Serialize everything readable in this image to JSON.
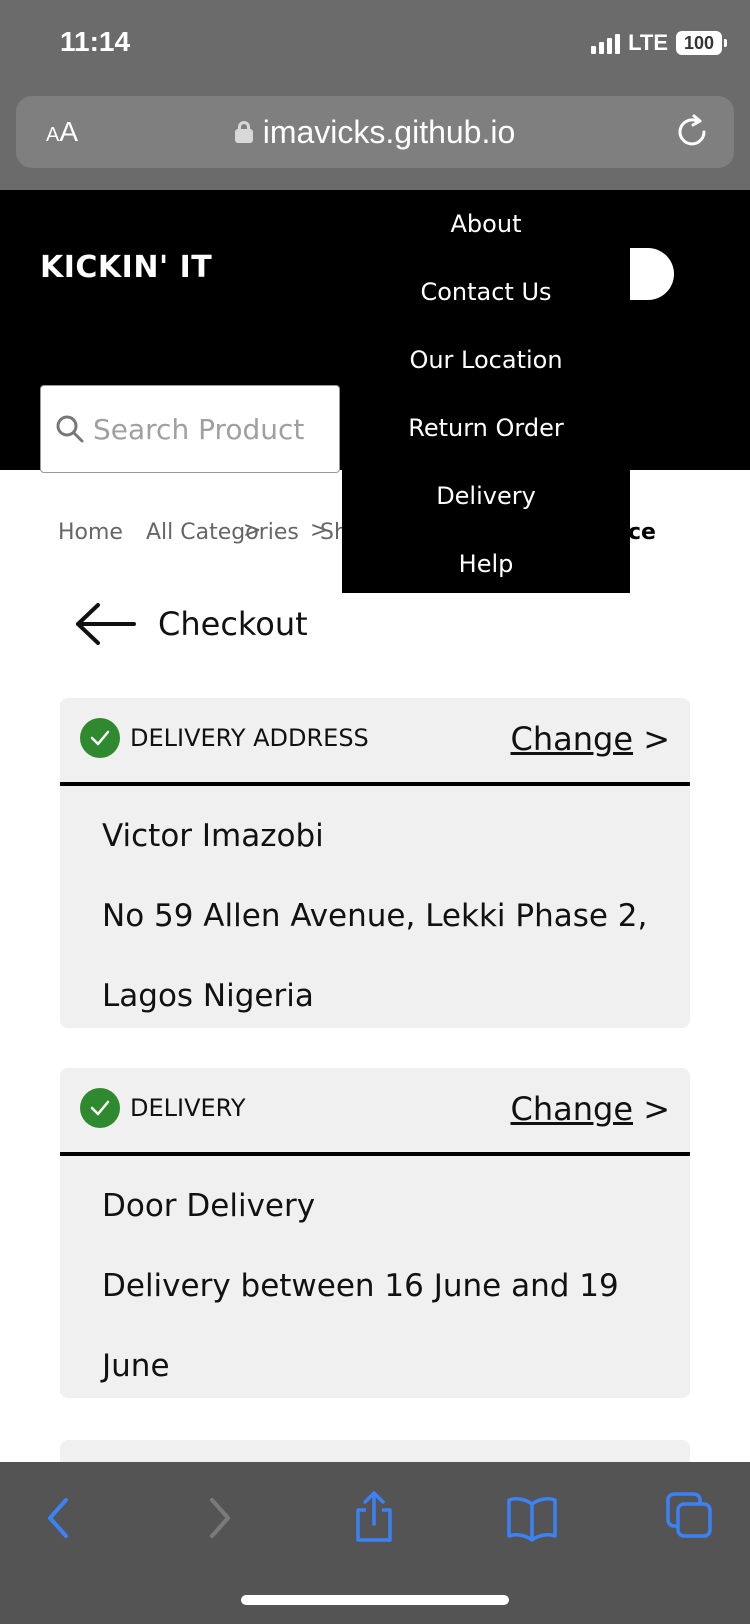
{
  "status_bar": {
    "time": "11:14",
    "network": "LTE",
    "battery": "100"
  },
  "browser": {
    "aa_small": "A",
    "aa_big": "A",
    "url": "imavicks.github.io"
  },
  "header": {
    "brand": "KICKIN' IT",
    "search_placeholder": "Search Product"
  },
  "dropdown": {
    "items": [
      "About",
      "Contact Us",
      "Our Location",
      "Return Order",
      "Delivery",
      "Help"
    ]
  },
  "breadcrumb": {
    "home": "Home",
    "categories": "All Categories",
    "partial": "Sh",
    "tail": "ce",
    "sep": ">"
  },
  "checkout": {
    "title": "Checkout"
  },
  "cards": [
    {
      "title": "DELIVERY ADDRESS",
      "change": "Change",
      "arrow": ">",
      "lines": [
        "Victor Imazobi",
        "No 59 Allen Avenue, Lekki Phase 2,",
        "Lagos Nigeria"
      ]
    },
    {
      "title": "DELIVERY",
      "change": "Change",
      "arrow": ">",
      "lines": [
        "Door Delivery",
        "Delivery between 16 June and 19",
        "June"
      ]
    }
  ],
  "colors": {
    "check_green": "#2f8a2f",
    "toolbar_blue": "#3b82f6",
    "header_bg": "#000000",
    "card_bg": "#f0f0f0"
  },
  "icons": [
    "lock-icon",
    "reload-icon",
    "search-icon",
    "back-arrow-icon",
    "check-icon",
    "chevron-left-icon",
    "chevron-right-icon",
    "share-icon",
    "bookmarks-icon",
    "tabs-icon"
  ]
}
